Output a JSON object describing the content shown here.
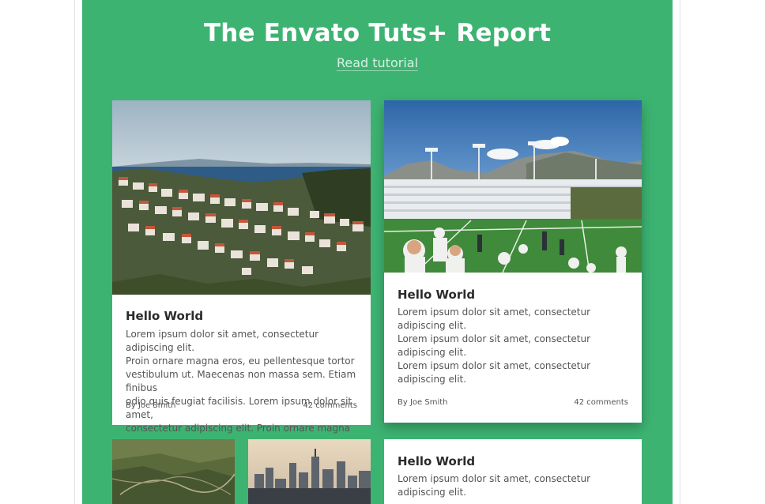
{
  "header": {
    "title": "The Envato Tuts+ Report",
    "link": "Read tutorial"
  },
  "cards": [
    {
      "image": "coastal-town-photo",
      "title": "Hello World",
      "lines": [
        "Lorem ipsum dolor sit amet, consectetur adipiscing elit.",
        "Proin ornare magna eros, eu pellentesque tortor",
        "vestibulum ut. Maecenas non massa sem. Etiam finibus",
        "odio quis feugiat facilisis. Lorem ipsum dolor sit amet,",
        "consectetur adipiscing elit. Proin ornare magna eros."
      ],
      "author": "By Joe Smith",
      "comments": "42 comments"
    },
    {
      "image": "football-stadium-photo",
      "title": "Hello World",
      "lines": [
        "Lorem ipsum dolor sit amet, consectetur adipiscing elit.",
        "Lorem ipsum dolor sit amet, consectetur adipiscing elit.",
        "Lorem ipsum dolor sit amet, consectetur adipiscing elit."
      ],
      "author": "By Joe Smith",
      "comments": "42 comments"
    },
    {
      "image": "aerial-forest-photo"
    },
    {
      "image": "city-skyline-photo"
    },
    {
      "title": "Hello World",
      "lines": [
        "Lorem ipsum dolor sit amet, consectetur adipiscing elit."
      ]
    }
  ],
  "colors": {
    "background": "#3db372",
    "card": "#ffffff",
    "title_text": "#ffffff"
  }
}
